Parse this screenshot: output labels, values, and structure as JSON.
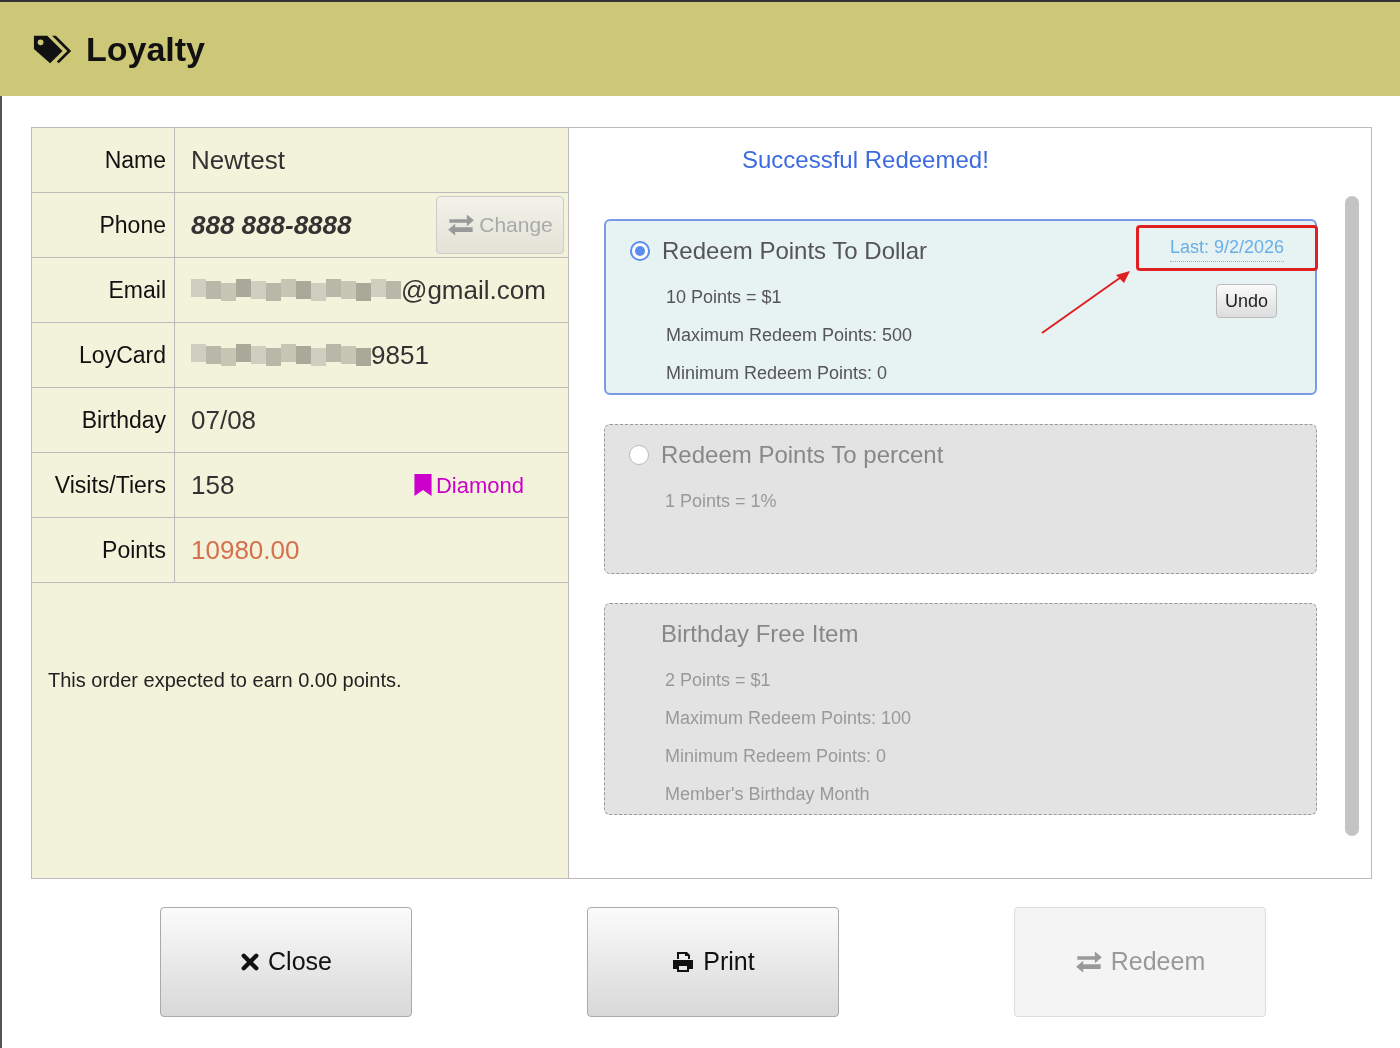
{
  "window": {
    "title": "Loyalty"
  },
  "customer": {
    "rows": [
      {
        "label": "Name",
        "value": "Newtest",
        "kind": "text"
      },
      {
        "label": "Phone",
        "value": "888 888-8888",
        "kind": "phone",
        "button": "Change"
      },
      {
        "label": "Email",
        "value": "@gmail.com",
        "kind": "redacted"
      },
      {
        "label": "LoyCard",
        "value": "9851",
        "kind": "redacted"
      },
      {
        "label": "Birthday",
        "value": "07/08",
        "kind": "text"
      },
      {
        "label": "Visits/Tiers",
        "value": "158",
        "kind": "tier",
        "tier": "Diamond"
      },
      {
        "label": "Points",
        "value": "10980.00",
        "kind": "points"
      }
    ],
    "note": "This order expected to earn 0.00 points."
  },
  "message": "Successful Redeemed!",
  "options": [
    {
      "kind": "radio",
      "title": "Redeem Points To Dollar",
      "selected": true,
      "highlighted": true,
      "last": "Last: 9/2/2026",
      "undo": "Undo",
      "lines": [
        "10 Points = $1",
        "Maximum Redeem Points: 500",
        "Minimum Redeem Points: 0"
      ]
    },
    {
      "kind": "radio",
      "title": "Redeem Points To percent",
      "selected": false,
      "highlighted": false,
      "lines": [
        "1 Points = 1%"
      ]
    },
    {
      "kind": "plain",
      "title": "Birthday Free Item",
      "selected": false,
      "highlighted": false,
      "lines": [
        "2 Points = $1",
        "Maximum Redeem Points: 100",
        "Minimum Redeem Points: 0",
        "Member's Birthday Month"
      ]
    }
  ],
  "buttons": [
    {
      "label": "Close",
      "kind": "close",
      "disabled": false
    },
    {
      "label": "Print",
      "kind": "print",
      "disabled": false
    },
    {
      "label": "Redeem",
      "kind": "redeem",
      "disabled": true
    }
  ]
}
